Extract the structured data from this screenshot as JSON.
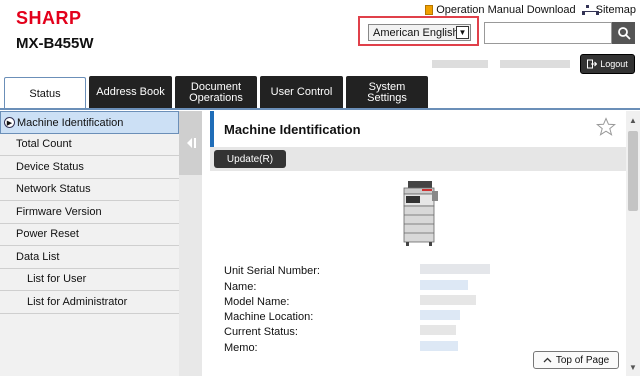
{
  "header": {
    "brand": "SHARP",
    "model": "MX-B455W",
    "links": [
      {
        "label": "Operation Manual Download",
        "icon": "book-icon"
      },
      {
        "label": "Sitemap",
        "icon": "sitemap-icon"
      }
    ],
    "language": {
      "selected": "American English"
    },
    "search": {
      "value": "",
      "placeholder": ""
    },
    "logout_label": "Logout"
  },
  "tabs": [
    {
      "label": "Status",
      "active": true
    },
    {
      "label": "Address Book"
    },
    {
      "label": "Document Operations"
    },
    {
      "label": "User Control"
    },
    {
      "label": "System Settings"
    }
  ],
  "sidebar": {
    "items": [
      {
        "label": "Machine Identification",
        "active": true
      },
      {
        "label": "Total Count"
      },
      {
        "label": "Device Status"
      },
      {
        "label": "Network Status"
      },
      {
        "label": "Firmware Version"
      },
      {
        "label": "Power Reset"
      },
      {
        "label": "Data List"
      },
      {
        "label": "List for User",
        "indent": true
      },
      {
        "label": "List for Administrator",
        "indent": true
      }
    ]
  },
  "main": {
    "title": "Machine Identification",
    "update_label": "Update(R)",
    "fields": [
      {
        "label": "Unit Serial Number:"
      },
      {
        "label": "Name:"
      },
      {
        "label": "Model Name:"
      },
      {
        "label": "Machine Location:"
      },
      {
        "label": "Current Status:"
      },
      {
        "label": "Memo:"
      }
    ],
    "top_of_page_label": "Top of Page"
  },
  "colors": {
    "brand_red": "#e3001b",
    "tab_dark": "#222222",
    "accent_blue": "#1f6db8",
    "highlight_box": "#e0404a"
  }
}
